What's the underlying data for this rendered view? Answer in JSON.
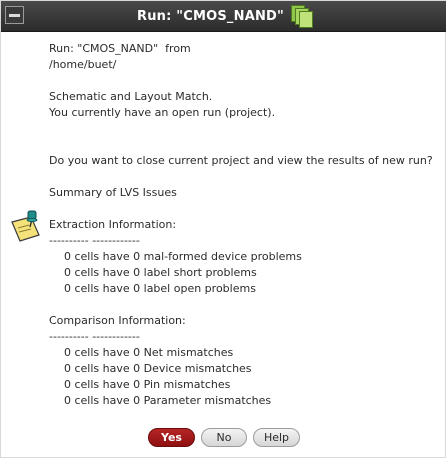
{
  "window": {
    "title": "Run: \"CMOS_NAND\"",
    "title_icon": "stacked-pages-icon",
    "system_menu_icon": "window-menu-icon"
  },
  "message": {
    "run_line": "Run: \"CMOS_NAND\"  from",
    "path": "/home/buet/",
    "match_line": "Schematic and Layout Match.",
    "open_run_line": "You currently have an open run (project).",
    "question": "Do you want to close current project and view the results of new run?",
    "summary_title": "Summary of LVS Issues",
    "extraction": {
      "heading": "Extraction Information:",
      "rule": "---------- ------------",
      "items": [
        "0 cells have 0 mal-formed device problems",
        "0 cells have 0 label short problems",
        "0 cells have 0 label open problems"
      ]
    },
    "comparison": {
      "heading": "Comparison Information:",
      "rule": "---------- ------------",
      "items": [
        "0 cells have 0 Net mismatches",
        "0 cells have 0 Device mismatches",
        "0 cells have 0 Pin mismatches",
        "0 cells have 0 Parameter mismatches"
      ]
    },
    "info_icon": "note-pin-icon"
  },
  "buttons": {
    "yes": "Yes",
    "no": "No",
    "help": "Help"
  },
  "colors": {
    "titlebar": "#2c2c2c",
    "primary_button": "#a01a1a",
    "text": "#2b2b2b"
  }
}
